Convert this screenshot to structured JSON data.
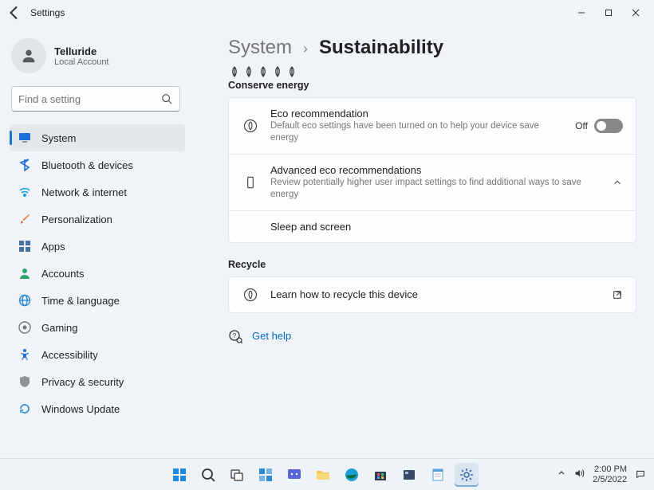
{
  "titlebar": {
    "title": "Settings"
  },
  "profile": {
    "name": "Telluride",
    "sub": "Local Account"
  },
  "search": {
    "placeholder": "Find a setting"
  },
  "nav": {
    "items": [
      {
        "label": "System"
      },
      {
        "label": "Bluetooth & devices"
      },
      {
        "label": "Network & internet"
      },
      {
        "label": "Personalization"
      },
      {
        "label": "Apps"
      },
      {
        "label": "Accounts"
      },
      {
        "label": "Time & language"
      },
      {
        "label": "Gaming"
      },
      {
        "label": "Accessibility"
      },
      {
        "label": "Privacy & security"
      },
      {
        "label": "Windows Update"
      }
    ]
  },
  "breadcrumb": {
    "root": "System",
    "current": "Sustainability"
  },
  "sections": {
    "conserve": {
      "label": "Conserve energy",
      "eco": {
        "title": "Eco recommendation",
        "sub": "Default eco settings have been turned on to help your device save energy",
        "state_label": "Off"
      },
      "advanced": {
        "title": "Advanced eco recommendations",
        "sub": "Review potentially higher user impact settings to find additional ways to save energy",
        "sub_items": [
          {
            "label": "Sleep and screen"
          }
        ]
      }
    },
    "recycle": {
      "label": "Recycle",
      "learn": {
        "title": "Learn how to recycle this device"
      }
    }
  },
  "help": {
    "label": "Get help"
  },
  "taskbar": {
    "time": "2:00 PM",
    "date": "2/5/2022"
  }
}
